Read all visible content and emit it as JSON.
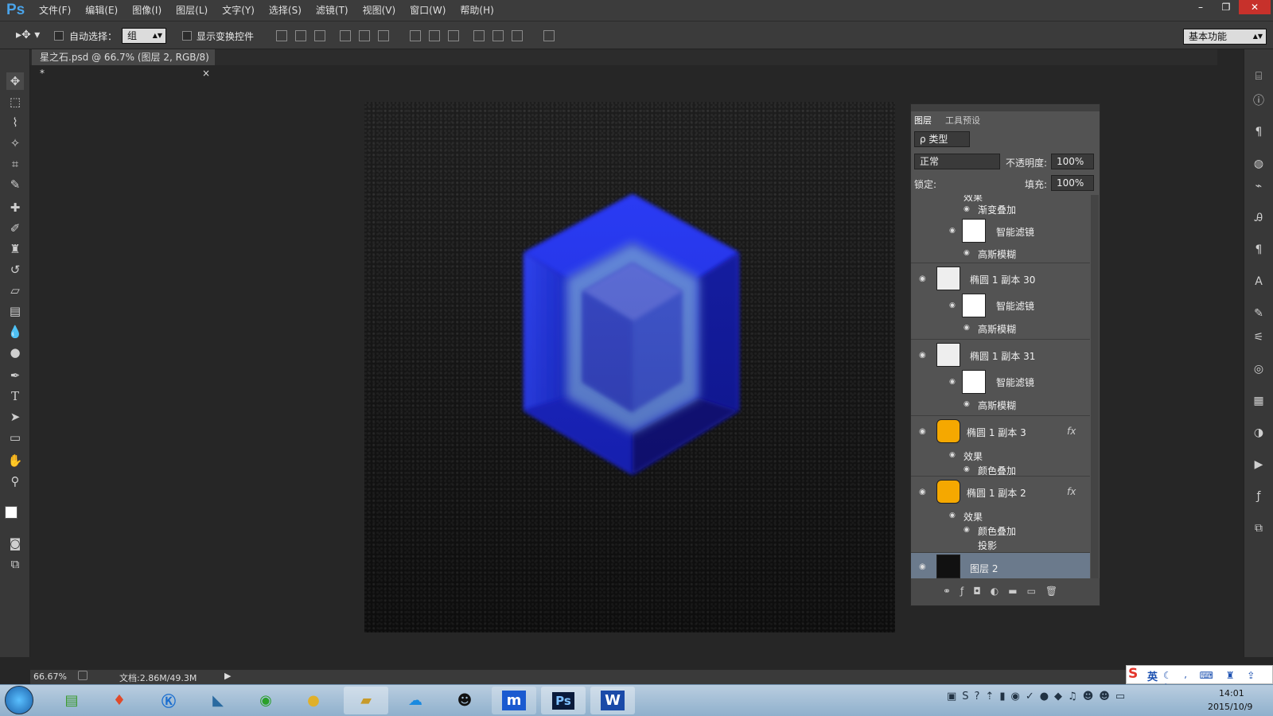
{
  "app": {
    "logo": "Ps"
  },
  "menu": [
    "文件(F)",
    "编辑(E)",
    "图像(I)",
    "图层(L)",
    "文字(Y)",
    "选择(S)",
    "滤镜(T)",
    "视图(V)",
    "窗口(W)",
    "帮助(H)"
  ],
  "window_controls": {
    "minimize": "–",
    "restore": "❐",
    "close": "✕"
  },
  "options": {
    "auto_select_label": "自动选择：",
    "auto_select_value": "组",
    "show_transform_label": "显示变换控件",
    "workspace": "基本功能"
  },
  "document": {
    "tab_title": "星之石.psd @ 66.7% (图层 2, RGB/8) *",
    "close": "×"
  },
  "layers_panel": {
    "tabs": [
      "图层",
      "工具预设"
    ],
    "filter_label": "ρ 类型",
    "blend_mode": "正常",
    "opacity_label": "不透明度:",
    "opacity_value": "100%",
    "lock_label": "锁定:",
    "fill_label": "填充:",
    "fill_value": "100%",
    "rows": [
      {
        "text": "效果"
      },
      {
        "text": "渐变叠加"
      },
      {
        "text": "智能滤镜"
      },
      {
        "text": "高斯模糊"
      },
      {
        "text": "椭圆 1 副本 30"
      },
      {
        "text": "智能滤镜"
      },
      {
        "text": "高斯模糊"
      },
      {
        "text": "椭圆 1 副本 31"
      },
      {
        "text": "智能滤镜"
      },
      {
        "text": "高斯模糊"
      },
      {
        "text": "椭圆 1 副本 3"
      },
      {
        "text": "效果"
      },
      {
        "text": "颜色叠加"
      },
      {
        "text": "椭圆 1 副本 2"
      },
      {
        "text": "效果"
      },
      {
        "text": "颜色叠加"
      },
      {
        "text": "投影"
      },
      {
        "text": "图层 2"
      }
    ],
    "fx_label": "fx"
  },
  "status": {
    "zoom": "66.67%",
    "doc_info": "文档:2.86M/49.3M"
  },
  "taskbar": {
    "ime": "英",
    "time": "14:01",
    "date": "2015/10/9"
  },
  "colors": {
    "gem_blue": "#1f2cff",
    "panel_bg": "#535353",
    "selected_layer": "#6b7a8c"
  }
}
